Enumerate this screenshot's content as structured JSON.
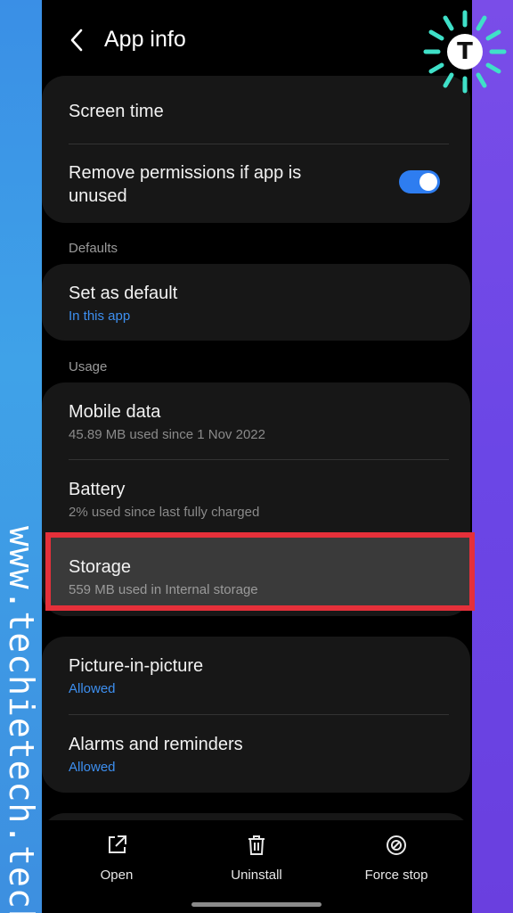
{
  "watermark": "www.techietech.tech",
  "logo_letter": "T",
  "header": {
    "title": "App info"
  },
  "card1": {
    "screen_time": "Screen time",
    "remove_permissions": "Remove permissions if app is unused",
    "remove_permissions_enabled": true
  },
  "defaults": {
    "section": "Defaults",
    "set_default": {
      "label": "Set as default",
      "sub": "In this app"
    }
  },
  "usage": {
    "section": "Usage",
    "mobile_data": {
      "label": "Mobile data",
      "sub": "45.89 MB used since 1 Nov 2022"
    },
    "battery": {
      "label": "Battery",
      "sub": "2% used since last fully charged"
    },
    "storage": {
      "label": "Storage",
      "sub": "559 MB used in Internal storage"
    }
  },
  "advanced": {
    "pip": {
      "label": "Picture-in-picture",
      "sub": "Allowed"
    },
    "alarms": {
      "label": "Alarms and reminders",
      "sub": "Allowed"
    }
  },
  "actions": {
    "open": "Open",
    "uninstall": "Uninstall",
    "force_stop": "Force stop"
  },
  "colors": {
    "accent": "#3d8ff0",
    "highlight": "#e5303a",
    "toggle": "#2e7df0"
  }
}
